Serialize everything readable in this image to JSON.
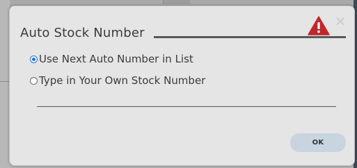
{
  "dialog": {
    "title": "Auto Stock Number",
    "close_glyph": "✕",
    "icons": {
      "warning": "warning-triangle-icon",
      "close": "close-icon"
    },
    "options": [
      {
        "label": "Use Next Auto Number in List",
        "checked": true
      },
      {
        "label": "Type in Your Own Stock Number",
        "checked": false
      }
    ],
    "ok_label": "OK"
  },
  "colors": {
    "warning_red": "#c0272d",
    "radio_selected": "#1a73e8",
    "ok_button_bg": "#c9d4e1",
    "dialog_bg": "#e5e5e5"
  }
}
